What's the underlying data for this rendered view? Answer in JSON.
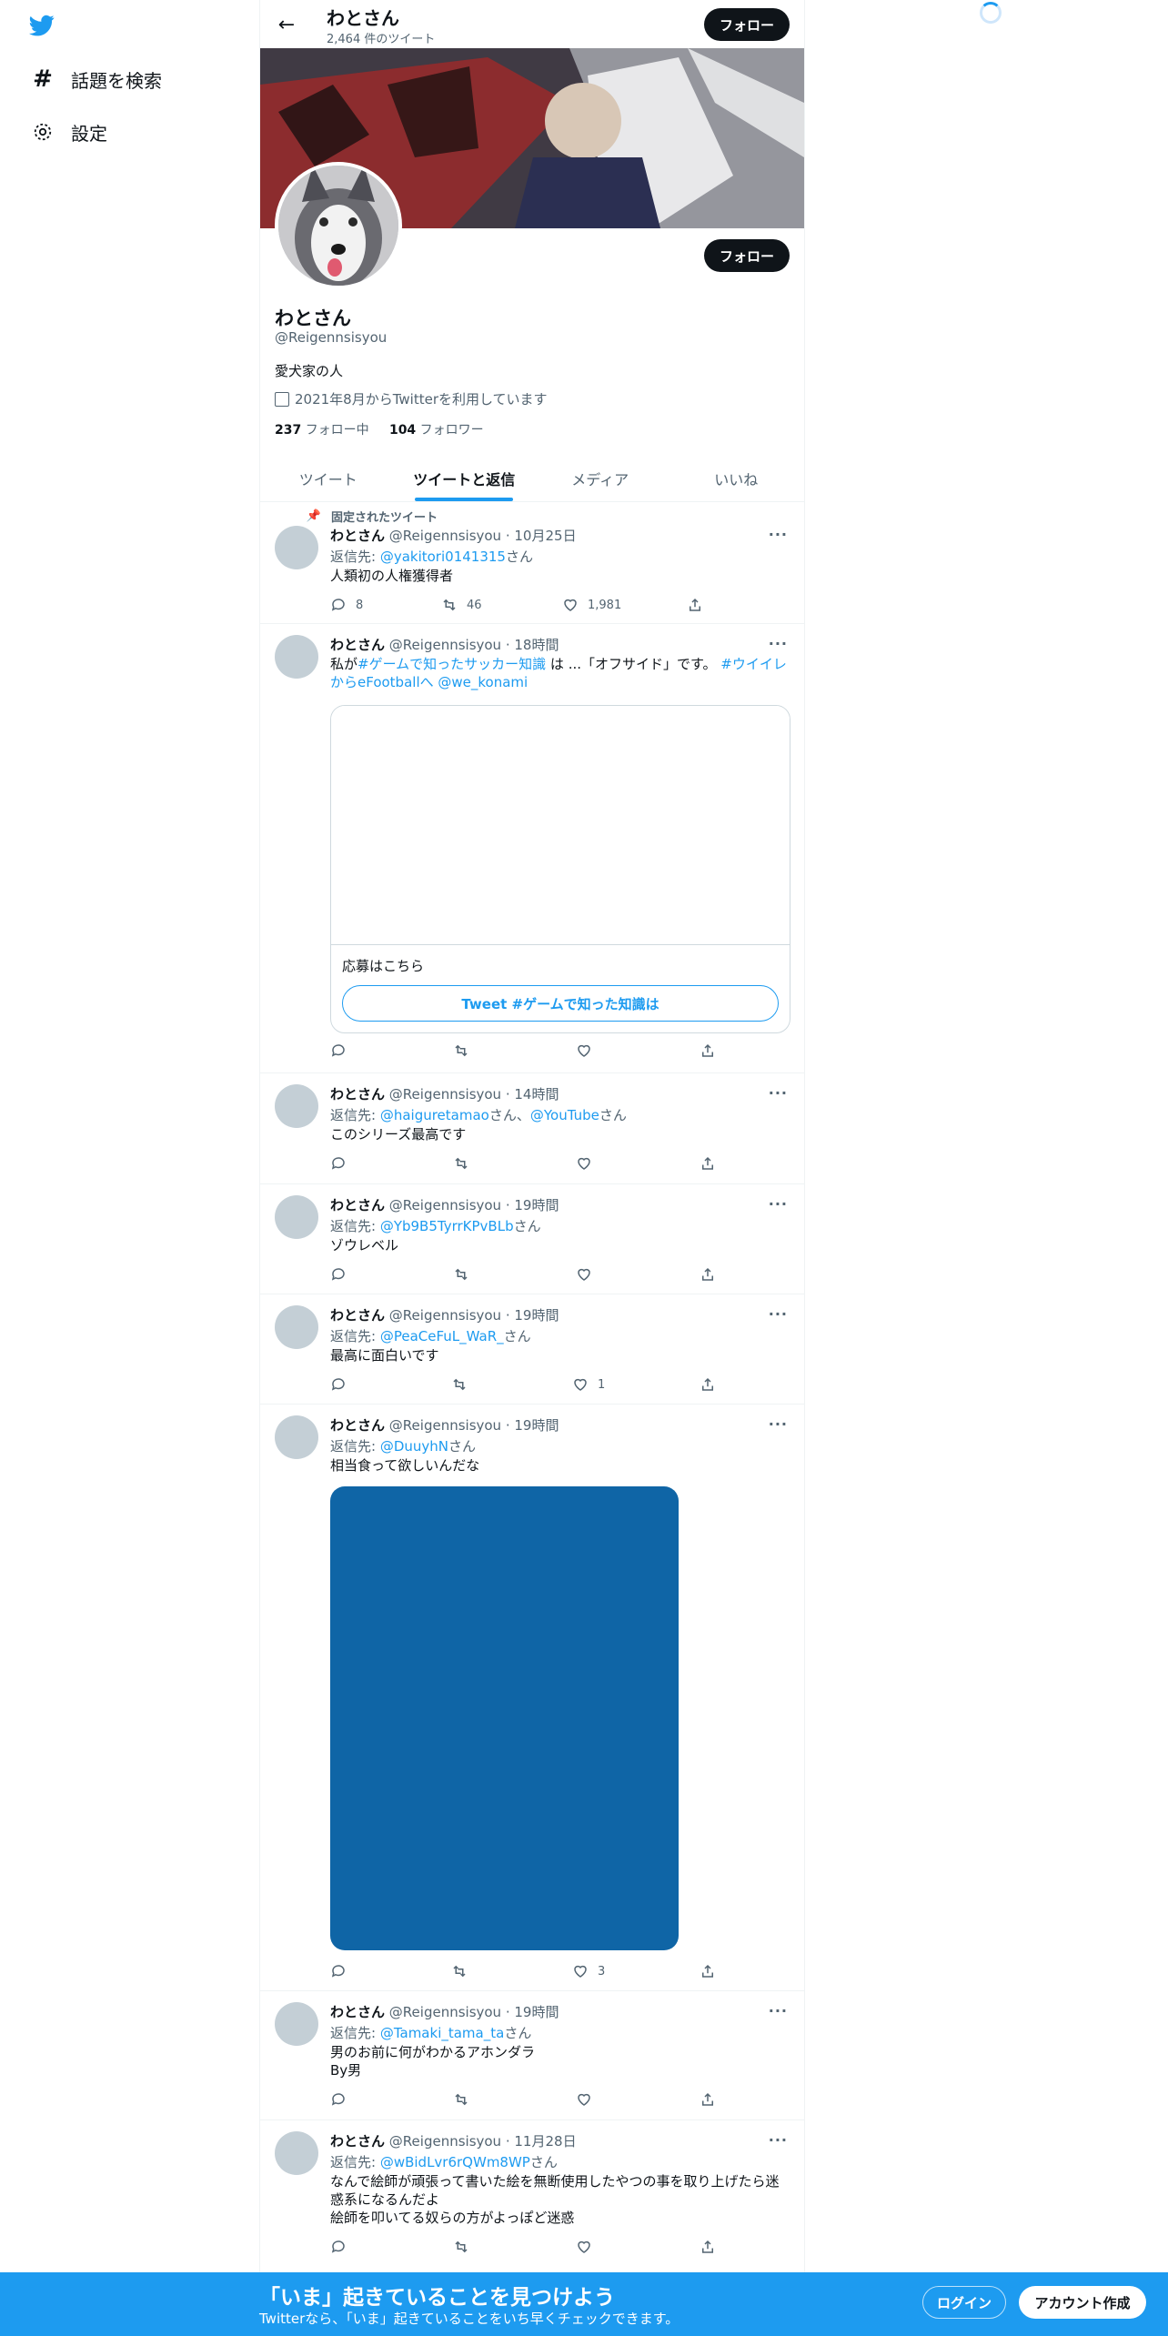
{
  "nav": {
    "logo_icon": "twitter-bird-icon",
    "items": [
      {
        "label": "話題を検索",
        "icon": "hashtag-icon"
      },
      {
        "label": "設定",
        "icon": "gear-icon"
      }
    ]
  },
  "header": {
    "name": "わとさん",
    "tweet_count": "2,464 件のツイート",
    "follow_label": "フォロー"
  },
  "profile": {
    "name": "わとさん",
    "handle": "@Reigennsisyou",
    "bio": "愛犬家の人",
    "joined": "2021年8月からTwitterを利用しています",
    "following_count": "237",
    "following_label": "フォロー中",
    "followers_count": "104",
    "followers_label": "フォロワー",
    "follow_label": "フォロー"
  },
  "tabs": [
    "ツイート",
    "ツイートと返信",
    "メディア",
    "いいね"
  ],
  "pinned_label": "固定されたツイート",
  "tweets": [
    {
      "name": "わとさん",
      "handle": "@Reigennsisyou",
      "time": "10月25日",
      "reply_prefix": "返信先: ",
      "reply_to": "@yakitori0141315",
      "reply_suffix": "さん",
      "text": "人類初の人権獲得者",
      "replies": "8",
      "retweets": "46",
      "likes": "1,981"
    },
    {
      "name": "わとさん",
      "handle": "@Reigennsisyou",
      "time": "18時間",
      "text_1": "私が",
      "hashtag_1": "#ゲームで知ったサッカー知識",
      "text_2": "は ...「オフサイド」です。",
      "hashtag_2": "#ウイイレからeFootballへ",
      "mention": "@we_konami",
      "card_label": "応募はこちら",
      "card_button": "Tweet #ゲームで知った知識は",
      "replies": "",
      "retweets": "",
      "likes": ""
    },
    {
      "name": "わとさん",
      "handle": "@Reigennsisyou",
      "time": "14時間",
      "reply_prefix": "返信先: ",
      "reply_to": "@haiguretamao",
      "reply_mid": "さん、",
      "reply_to_2": "@YouTube",
      "reply_suffix": "さん",
      "text": "このシリーズ最高です",
      "replies": "",
      "retweets": "",
      "likes": ""
    },
    {
      "name": "わとさん",
      "handle": "@Reigennsisyou",
      "time": "19時間",
      "reply_prefix": "返信先: ",
      "reply_to": "@Yb9B5TyrrKPvBLb",
      "reply_suffix": "さん",
      "text": "ゾウレベル",
      "replies": "",
      "retweets": "",
      "likes": ""
    },
    {
      "name": "わとさん",
      "handle": "@Reigennsisyou",
      "time": "19時間",
      "reply_prefix": "返信先: ",
      "reply_to": "@PeaCeFuL_WaR_",
      "reply_suffix": "さん",
      "text": "最高に面白いです",
      "replies": "",
      "retweets": "",
      "likes": "1"
    },
    {
      "name": "わとさん",
      "handle": "@Reigennsisyou",
      "time": "19時間",
      "reply_prefix": "返信先: ",
      "reply_to": "@DuuyhN",
      "reply_suffix": "さん",
      "text": "相当食って欲しいんだな",
      "replies": "",
      "retweets": "",
      "likes": "3"
    },
    {
      "name": "わとさん",
      "handle": "@Reigennsisyou",
      "time": "19時間",
      "reply_prefix": "返信先: ",
      "reply_to": "@Tamaki_tama_ta",
      "reply_suffix": "さん",
      "text_line1": "男のお前に何がわかるアホンダラ",
      "text_line2": "By男",
      "replies": "",
      "retweets": "",
      "likes": ""
    },
    {
      "name": "わとさん",
      "handle": "@Reigennsisyou",
      "time": "11月28日",
      "reply_prefix": "返信先: ",
      "reply_to": "@wBidLvr6rQWm8WP",
      "reply_suffix": "さん",
      "text_line1": "なんで絵師が頑張って書いた絵を無断使用したやつの事を取り上げたら迷惑系になるんだよ",
      "text_line2": "絵師を叩いてる奴らの方がよっぽど迷惑",
      "replies": "",
      "retweets": "",
      "likes": ""
    }
  ],
  "bottom": {
    "title": "「いま」起きていることを見つけよう",
    "subtitle": "Twitterなら、「いま」起きていることをいち早くチェックできます。",
    "login": "ログイン",
    "signup": "アカウント作成"
  },
  "colors": {
    "accent": "#1d9bf0",
    "text": "#0f1419",
    "muted": "#536471",
    "media": "#0f65a6"
  }
}
